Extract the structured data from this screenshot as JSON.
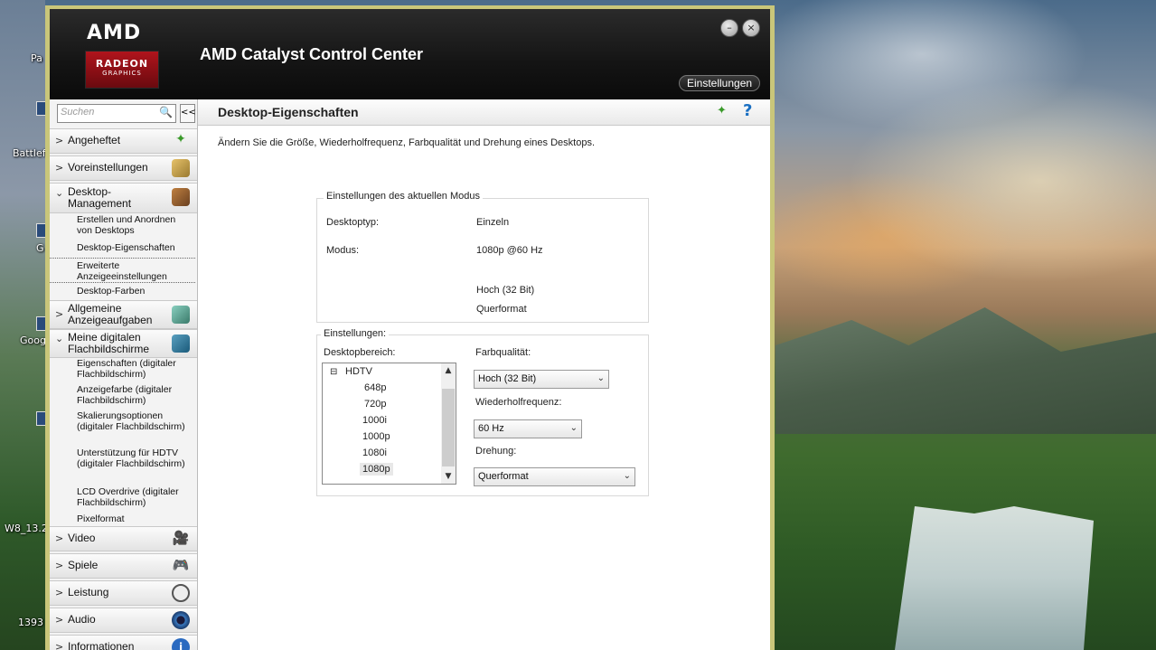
{
  "desktop": {
    "labels": [
      "Pa",
      "Battlef",
      "G",
      "Goog",
      "W8_13.2",
      "1393"
    ]
  },
  "app": {
    "brand_top": "AMD",
    "brand_radeon": "RADEON",
    "brand_graphics": "GRAPHICS",
    "title": "AMD Catalyst Control Center",
    "settings_button": "Einstellungen",
    "minimize_symbol": "–",
    "close_symbol": "×"
  },
  "sidebar": {
    "search_placeholder": "Suchen",
    "collapse_symbol": "<<",
    "categories": [
      {
        "label": "Angeheftet",
        "chevron": ">"
      },
      {
        "label": "Voreinstellungen",
        "chevron": ">"
      },
      {
        "label": "Desktop-\nManagement",
        "chevron": "⌄"
      },
      {
        "label": "Allgemeine\nAnzeigeaufgaben",
        "chevron": ">"
      },
      {
        "label": "Meine digitalen\nFlachbildschirme",
        "chevron": "⌄"
      },
      {
        "label": "Video",
        "chevron": ">"
      },
      {
        "label": "Spiele",
        "chevron": ">"
      },
      {
        "label": "Leistung",
        "chevron": ">"
      },
      {
        "label": "Audio",
        "chevron": ">"
      },
      {
        "label": "Informationen",
        "chevron": ">"
      }
    ],
    "desktop_management_items": [
      "Erstellen und Anordnen von Desktops",
      "Desktop-Eigenschaften",
      "Erweiterte Anzeigeeinstellungen",
      "Desktop-Farben"
    ],
    "flat_panel_items": [
      "Eigenschaften (digitaler Flachbildschirm)",
      "Anzeigefarbe (digitaler Flachbildschirm)",
      "Skalierungsoptionen (digitaler Flachbildschirm)",
      "Unterstützung für HDTV (digitaler Flachbildschirm)",
      "LCD Overdrive (digitaler Flachbildschirm)",
      "Pixelformat"
    ]
  },
  "content": {
    "title": "Desktop-Eigenschaften",
    "description": "Ändern Sie die Größe, Wiederholfrequenz, Farbqualität und Drehung eines Desktops.",
    "current_mode": {
      "legend": "Einstellungen des aktuellen Modus",
      "desktop_type_label": "Desktoptyp:",
      "desktop_type_value": "Einzeln",
      "mode_label": "Modus:",
      "mode_value": "1080p @60 Hz",
      "color_value": "Hoch (32 Bit)",
      "orientation_value": "Querformat"
    },
    "settings": {
      "legend": "Einstellungen:",
      "desktop_area_label": "Desktopbereich:",
      "tree_root": "HDTV",
      "tree_items": [
        "648p",
        "720p",
        "1000i",
        "1000p",
        "1080i",
        "1080p"
      ],
      "selected_item": "1080p",
      "color_quality_label": "Farbqualität:",
      "color_quality_value": "Hoch (32 Bit)",
      "refresh_label": "Wiederholfrequenz:",
      "refresh_value": "60 Hz",
      "rotation_label": "Drehung:",
      "rotation_value": "Querformat"
    }
  }
}
